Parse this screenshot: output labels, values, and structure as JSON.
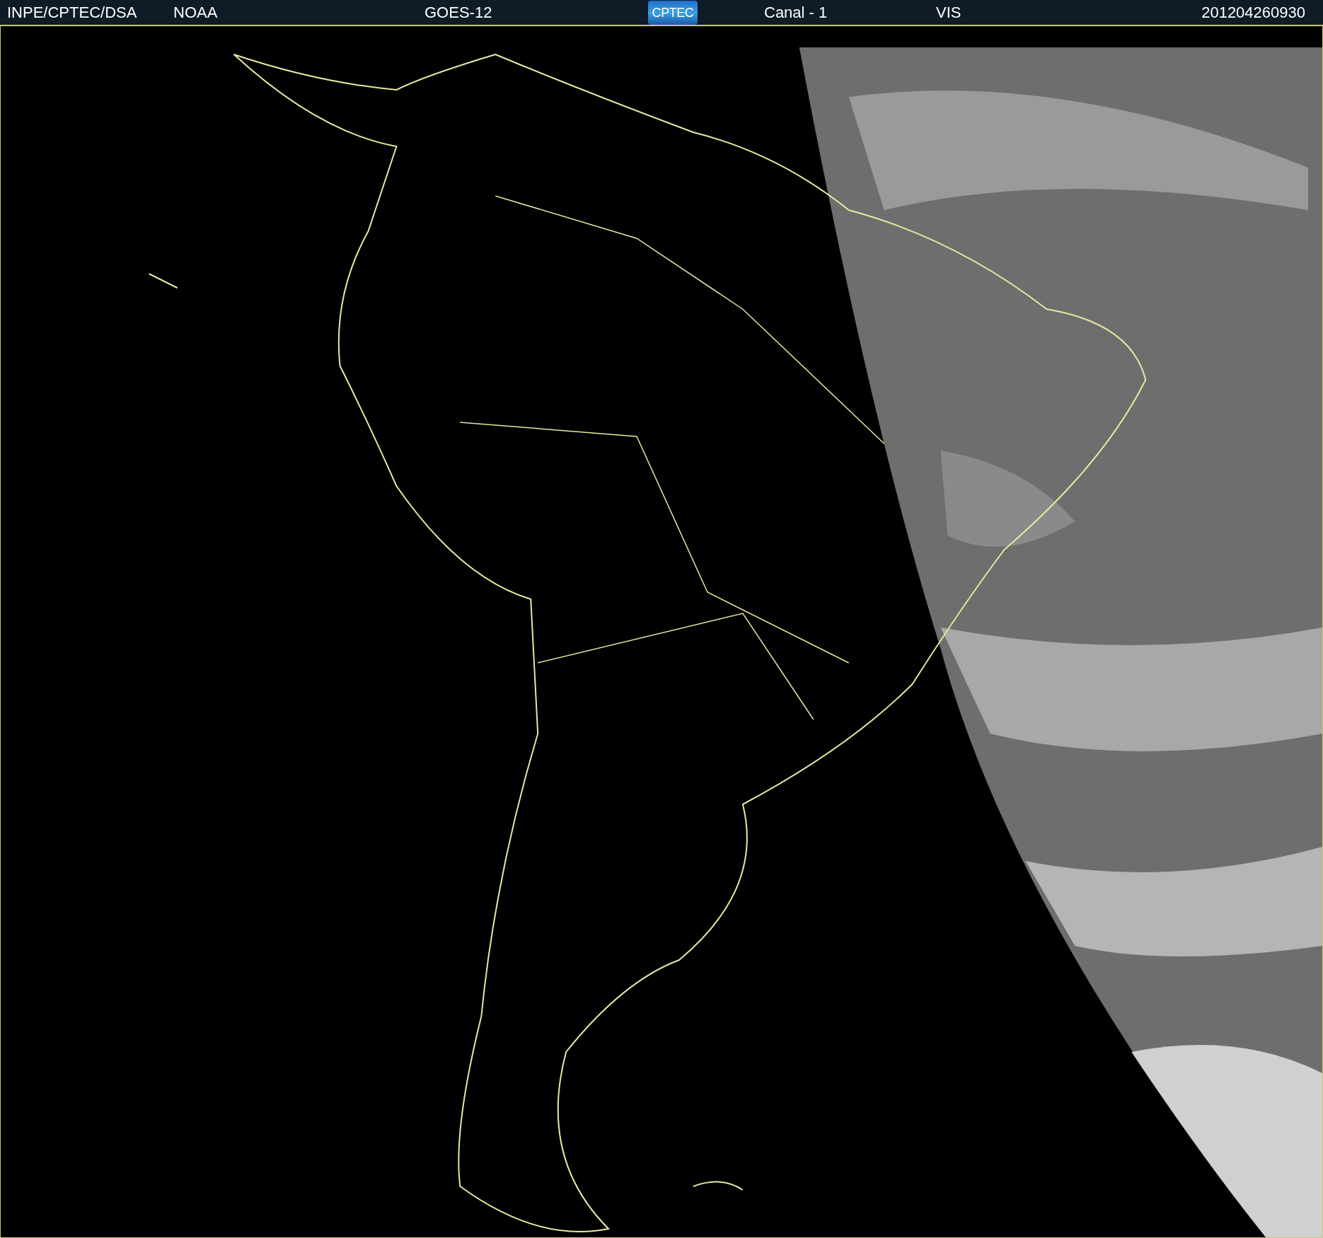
{
  "header": {
    "source": "INPE/CPTEC/DSA",
    "agency": "NOAA",
    "satellite": "GOES-12",
    "logo": "CPTEC",
    "channel": "Canal - 1",
    "band": "VIS",
    "timestamp": "201204260930"
  }
}
